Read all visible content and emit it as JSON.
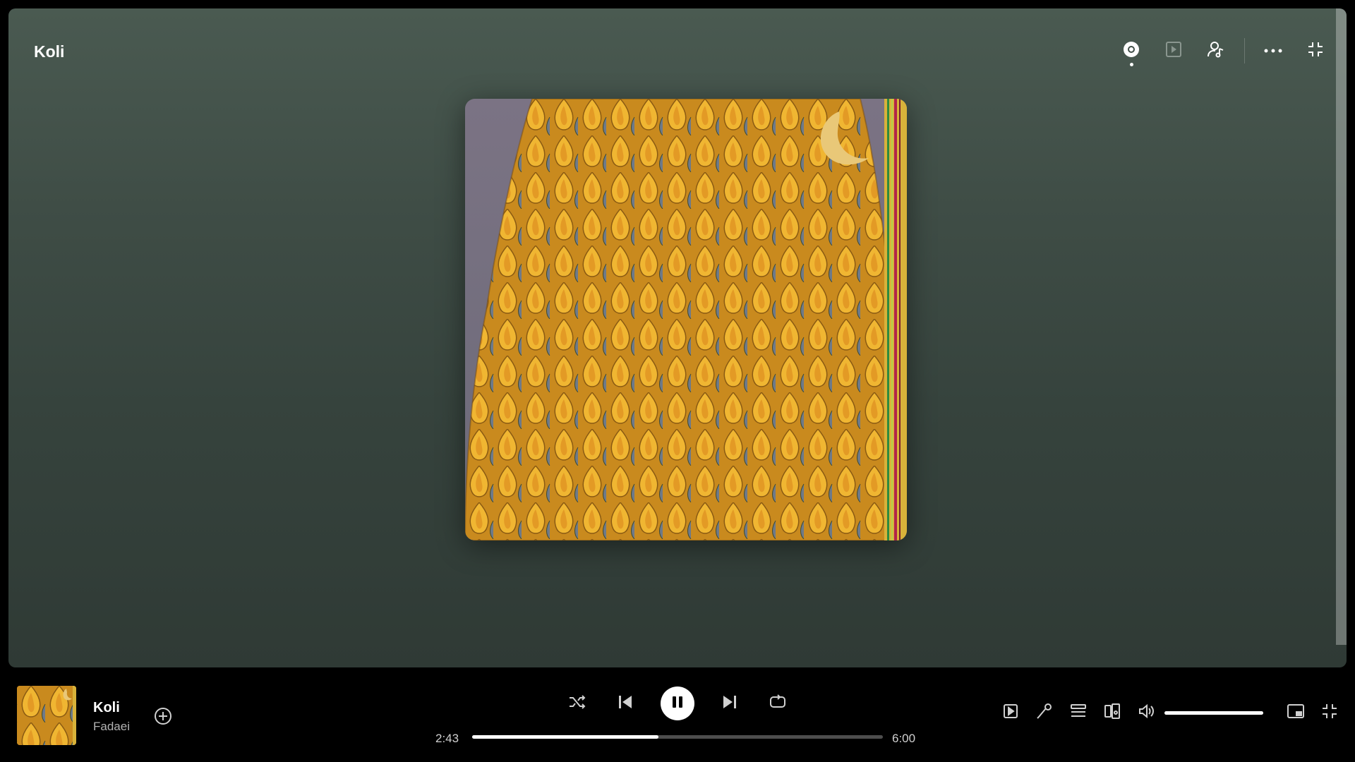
{
  "page": {
    "title": "Koli"
  },
  "top_actions": [
    {
      "name": "now-playing-view-icon",
      "active": true
    },
    {
      "name": "video-icon",
      "active": false
    },
    {
      "name": "artist-credits-icon",
      "active": false
    },
    {
      "name": "more-options-icon",
      "active": false
    },
    {
      "name": "exit-fullscreen-icon",
      "active": false
    }
  ],
  "now_playing": {
    "track": "Koli",
    "artist": "Fadaei",
    "artwork": "album-cover-flames-moon"
  },
  "playback": {
    "elapsed": "2:43",
    "duration": "6:00",
    "progress": 0.4528,
    "state": "playing"
  },
  "volume": {
    "level": 1.0
  },
  "colors": {
    "panel_top": "#4a5a51",
    "panel_bottom": "#2f3a35",
    "player_bg": "#000000",
    "accent": "#ffffff"
  },
  "controls": [
    "shuffle-icon",
    "previous-icon",
    "pause-icon",
    "next-icon",
    "repeat-icon"
  ],
  "right_controls": [
    "now-playing-view-icon",
    "lyrics-icon",
    "queue-icon",
    "connect-device-icon",
    "volume-icon",
    "miniplayer-icon",
    "fullscreen-icon"
  ]
}
